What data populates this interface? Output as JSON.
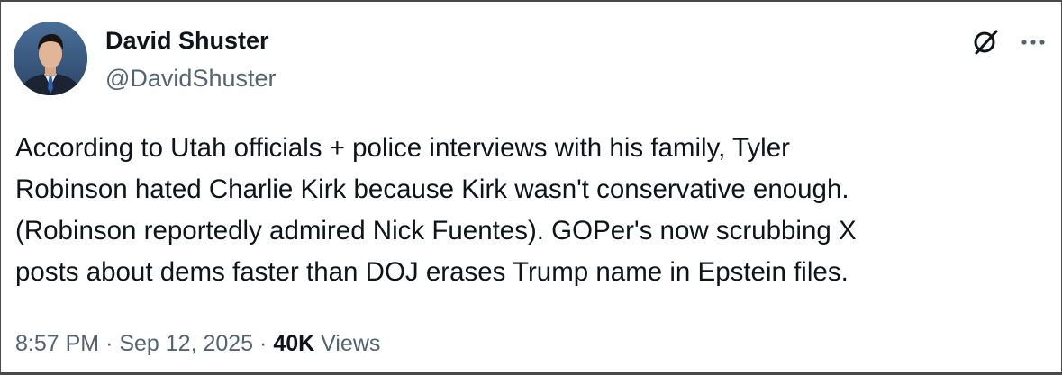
{
  "author": {
    "display_name": "David Shuster",
    "handle": "@DavidShuster",
    "avatar_icon": "profile-photo"
  },
  "actions": {
    "grok_icon": "grok-icon",
    "more_icon": "more-options-icon"
  },
  "tweet": {
    "text_lines": [
      "According to Utah officials + police interviews with his family, Tyler",
      "Robinson hated Charlie Kirk because Kirk wasn't conservative enough.",
      "(Robinson reportedly admired Nick Fuentes).  GOPer's now scrubbing X",
      "posts about dems faster than DOJ erases Trump name in Epstein files."
    ]
  },
  "meta": {
    "time": "8:57 PM",
    "separator": "·",
    "date": "Sep 12, 2025",
    "views_count": "40K",
    "views_label": "Views"
  },
  "colors": {
    "text_primary": "#0f1419",
    "text_secondary": "#536471",
    "border": "#4a4a4a"
  }
}
